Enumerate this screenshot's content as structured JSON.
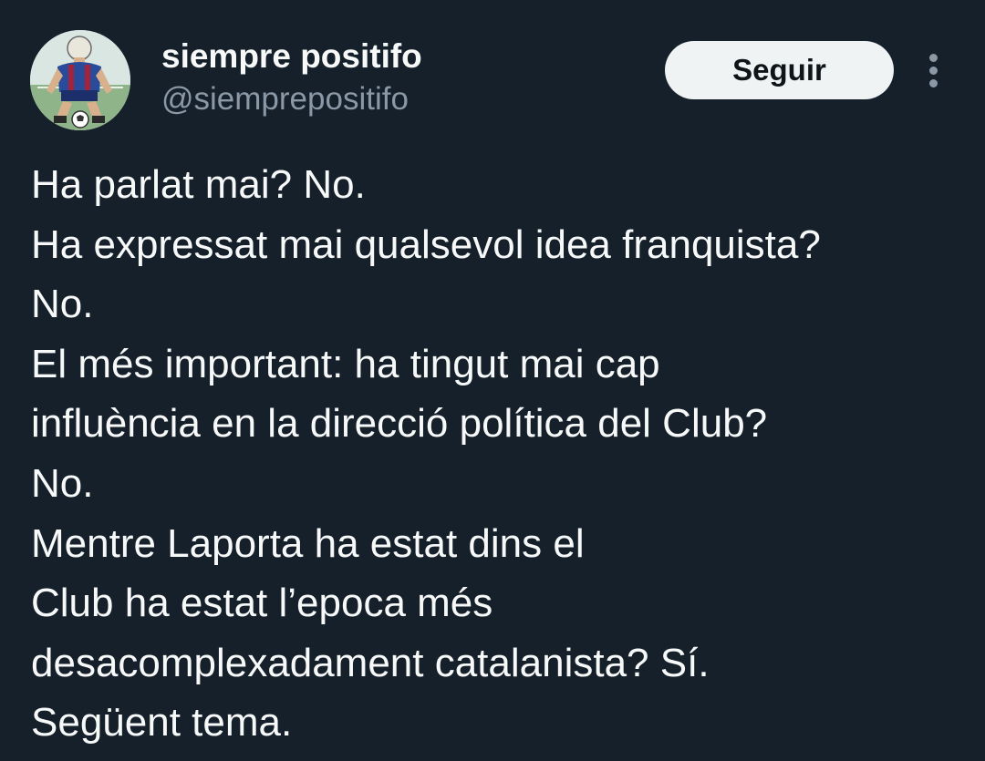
{
  "colors": {
    "background": "#15202b",
    "primary_text": "#f7f9f9",
    "secondary_text": "#8b98a5",
    "follow_button_bg": "#eff3f4",
    "follow_button_text": "#0f1419"
  },
  "author": {
    "display_name": "siempre positifo",
    "handle": "@siemprepositifo",
    "avatar_icon": "football-player-avatar"
  },
  "actions": {
    "follow_label": "Seguir",
    "more_icon": "more-vertical-icon"
  },
  "tweet": {
    "lines": [
      "Ha parlat mai? No.",
      "Ha expressat mai qualsevol idea franquista?",
      "No.",
      "El més important: ha tingut mai cap",
      "influència en la direcció política del Club?",
      "No.",
      "Mentre Laporta ha estat dins el",
      "Club ha estat l’epoca més",
      "desacomplexadament catalanista? Sí.",
      "Següent tema."
    ]
  }
}
